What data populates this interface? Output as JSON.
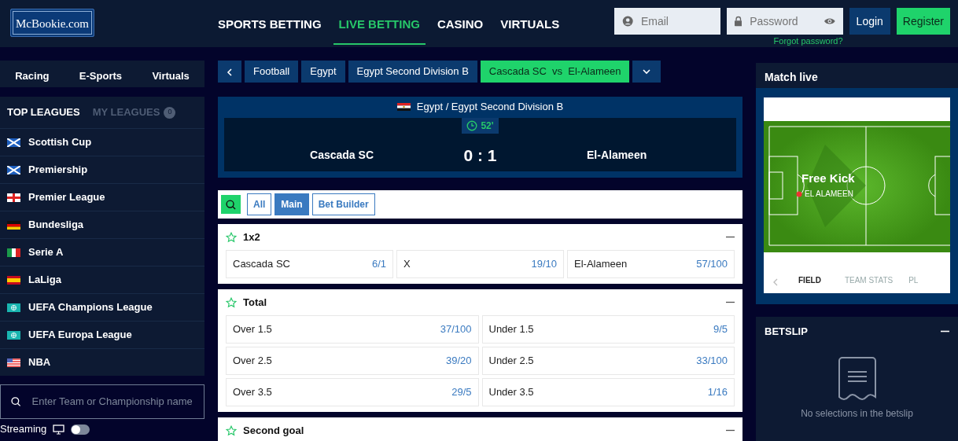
{
  "header": {
    "logo": "McBookie.com",
    "nav": [
      {
        "label": "SPORTS BETTING",
        "selected": false
      },
      {
        "label": "LIVE BETTING",
        "selected": true
      },
      {
        "label": "CASINO",
        "selected": false
      },
      {
        "label": "VIRTUALS",
        "selected": false
      }
    ],
    "email": {
      "placeholder": "Email"
    },
    "password": {
      "placeholder": "Password"
    },
    "forgot": "Forgot password?",
    "login": "Login",
    "register": "Register"
  },
  "sidebar": {
    "subnav": [
      "Racing",
      "E-Sports",
      "Virtuals"
    ],
    "league_tabs": [
      {
        "label": "TOP LEAGUES",
        "selected": true
      },
      {
        "label": "MY LEAGUES",
        "selected": false,
        "count": "0"
      }
    ],
    "leagues": [
      "Scottish Cup",
      "Premiership",
      "Premier League",
      "Bundesliga",
      "Serie A",
      "LaLiga",
      "UEFA Champions League",
      "UEFA Europa League",
      "NBA"
    ],
    "search": {
      "placeholder": "Enter Team or Championship name"
    },
    "streaming": {
      "label": "Streaming",
      "on": false
    }
  },
  "breadcrumbs": [
    {
      "label": "Football",
      "selected": false
    },
    {
      "label": "Egypt",
      "selected": false
    },
    {
      "label": "Egypt Second Division B",
      "selected": false
    },
    {
      "label": "Cascada SC  vs  El-Alameen",
      "selected": true
    }
  ],
  "match": {
    "competition": "Egypt / Egypt Second Division B",
    "time": "52'",
    "home": "Cascada SC",
    "score": "0 : 1",
    "away": "El-Alameen"
  },
  "filters": [
    {
      "label": "All",
      "selected": false
    },
    {
      "label": "Main",
      "selected": true
    },
    {
      "label": "Bet Builder",
      "selected": false
    }
  ],
  "markets": [
    {
      "title": "1x2",
      "favorite": false,
      "expanded": true,
      "outcomes": [
        {
          "name": "Cascada SC",
          "odds": "6/1"
        },
        {
          "name": "X",
          "odds": "19/10"
        },
        {
          "name": "El-Alameen",
          "odds": "57/100"
        }
      ]
    },
    {
      "title": "Total",
      "favorite": false,
      "expanded": true,
      "outcomes": [
        {
          "name": "Over 1.5",
          "odds": "37/100"
        },
        {
          "name": "Under 1.5",
          "odds": "9/5"
        },
        {
          "name": "Over 2.5",
          "odds": "39/20"
        },
        {
          "name": "Under 2.5",
          "odds": "33/100"
        },
        {
          "name": "Over 3.5",
          "odds": "29/5"
        },
        {
          "name": "Under 3.5",
          "odds": "1/16"
        }
      ]
    },
    {
      "title": "Second goal",
      "favorite": false,
      "expanded": true
    }
  ],
  "match_live": {
    "title": "Match live",
    "event": "Free Kick",
    "team": "EL ALAMEEN",
    "tabs": [
      {
        "label": "FIELD",
        "selected": true
      },
      {
        "label": "TEAM STATS",
        "selected": false
      },
      {
        "label": "PL",
        "selected": false
      }
    ]
  },
  "betslip": {
    "title": "BETSLIP",
    "expanded": true,
    "empty_text": "No selections in the betslip"
  }
}
